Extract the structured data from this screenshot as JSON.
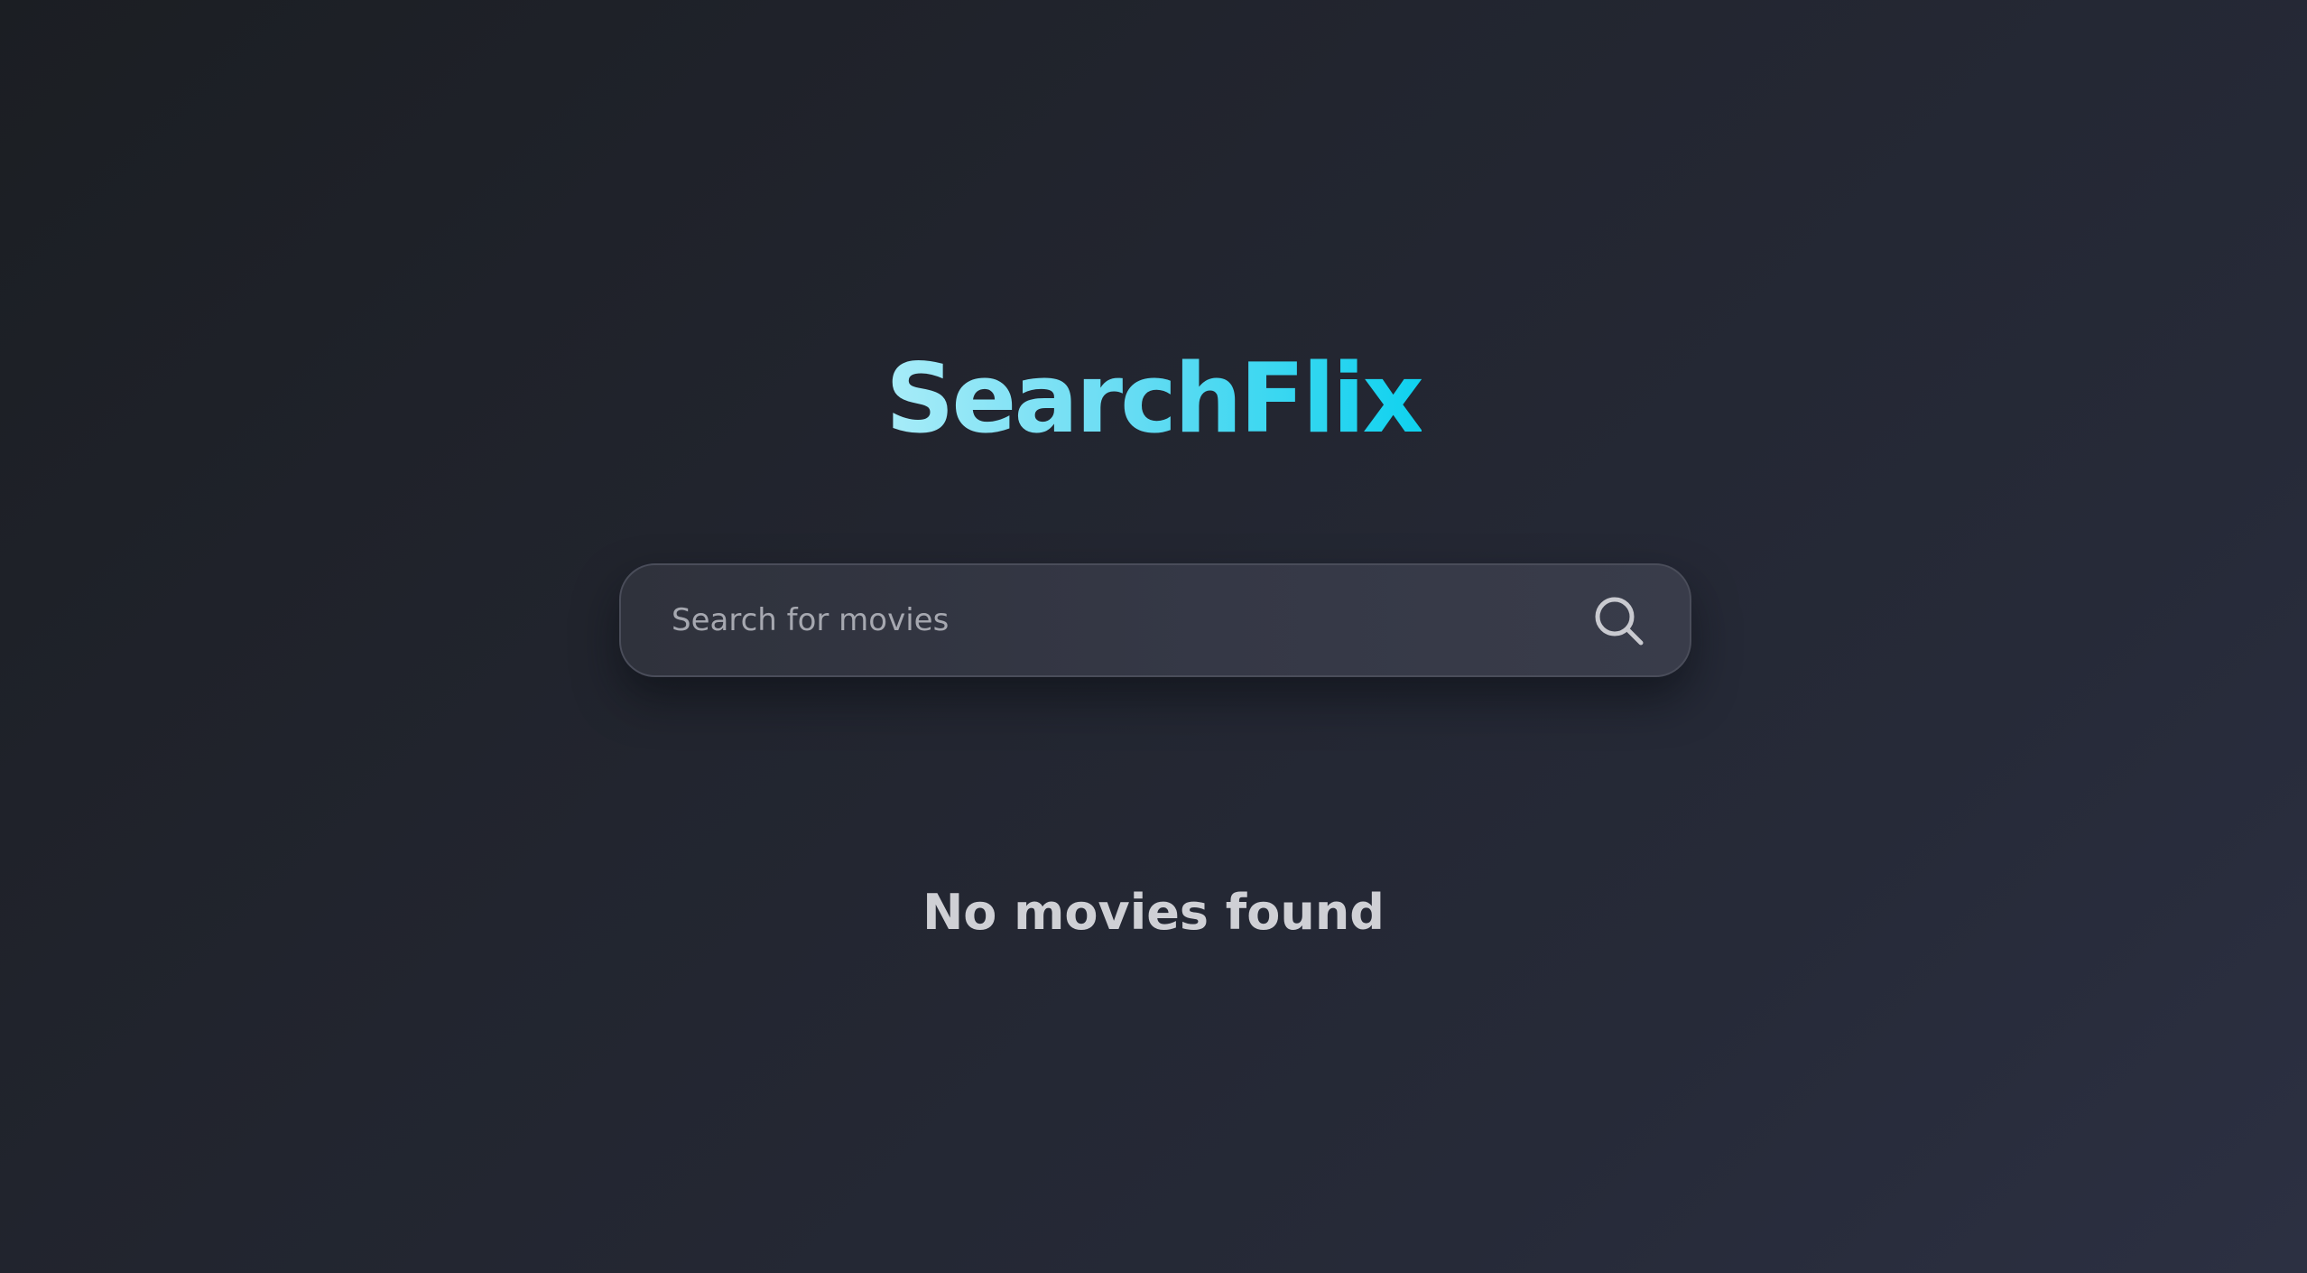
{
  "app": {
    "title": "SearchFlix"
  },
  "search": {
    "placeholder": "Search for movies",
    "value": ""
  },
  "results": {
    "empty_message": "No movies found"
  },
  "colors": {
    "background": "#22252f",
    "logo_gradient_start": "#a8ecf8",
    "logo_gradient_end": "#0fd2ef",
    "search_bar": "#353846",
    "muted_text": "#a6a8b0"
  },
  "icons": {
    "search_button": "search-icon"
  }
}
